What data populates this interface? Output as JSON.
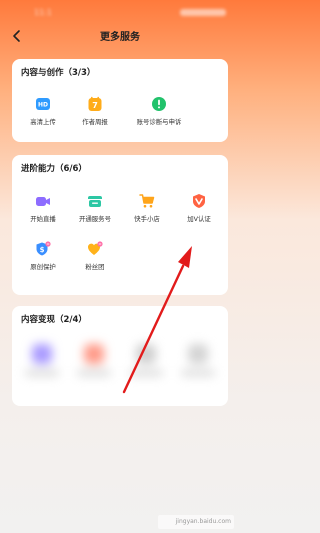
{
  "header": {
    "title": "更多服务"
  },
  "status_bar": {
    "time": "11:1"
  },
  "sections": [
    {
      "title": "内容与创作（3/3）",
      "items": [
        {
          "label": "高清上传",
          "icon": "hd-icon",
          "color": "#2f9bff"
        },
        {
          "label": "作者周报",
          "icon": "calendar-seven-icon",
          "color": "#ffac1a"
        },
        {
          "label": "账号诊断与申诉",
          "icon": "exclamation-icon",
          "color": "#21c26b"
        }
      ]
    },
    {
      "title": "进阶能力（6/6）",
      "items": [
        {
          "label": "开始直播",
          "icon": "video-camera-icon",
          "color": "#8d6cff"
        },
        {
          "label": "开通服务号",
          "icon": "service-bubble-icon",
          "color": "#2cc7a4"
        },
        {
          "label": "快手小店",
          "icon": "shopping-cart-icon",
          "color": "#ffa51a"
        },
        {
          "label": "加V认证",
          "icon": "verified-v-icon",
          "color": "#ff6342"
        },
        {
          "label": "原创保护",
          "icon": "shield-dollar-icon",
          "color": "#3a8fff"
        },
        {
          "label": "粉丝团",
          "icon": "heart-fan-icon",
          "color": "#ffb21a"
        }
      ]
    },
    {
      "title": "内容变现（2/4）",
      "blurred_colors": [
        "#a99aff",
        "#ff9a88",
        "#cfcfcf",
        "#d4d4d4"
      ]
    }
  ],
  "colors": {
    "accent": "#ff6a2e",
    "annotation_arrow": "#e21b1b"
  },
  "watermark": "jingyan.baidu.com"
}
